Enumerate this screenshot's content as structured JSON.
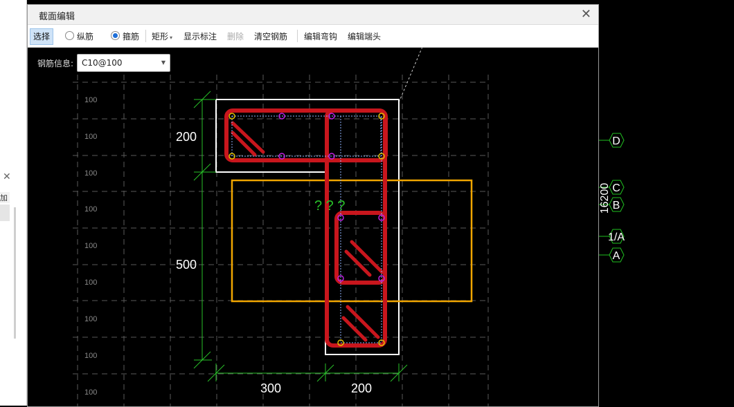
{
  "dialog": {
    "title": "截面编辑"
  },
  "toolbar": {
    "select": "选择",
    "longitudinal": "纵筋",
    "stirrup": "箍筋",
    "shape": "矩形",
    "show_annotation": "显示标注",
    "delete": "删除",
    "clear_rebar": "清空钢筋",
    "edit_hook": "编辑弯钩",
    "edit_end": "编辑端头"
  },
  "rebar_info": {
    "label": "钢筋信息:",
    "value": "C10@100"
  },
  "grid": {
    "spacing_label": "100"
  },
  "dimensions": {
    "top_height": "200",
    "lower_height": "500",
    "bottom_left": "300",
    "bottom_right": "200"
  },
  "question_marks": "? ? ?",
  "axes": {
    "d": "D",
    "c": "C",
    "b": "B",
    "one_a": "1/A",
    "a": "A",
    "span": "16200"
  },
  "colors": {
    "stirrup": "#c8161d",
    "outline": "#ffffff",
    "highlight": "#f0a500",
    "dim": "#29c229",
    "axis": "#21c021",
    "grid": "#6c6c6c"
  },
  "left_panel": {
    "label": "加"
  }
}
